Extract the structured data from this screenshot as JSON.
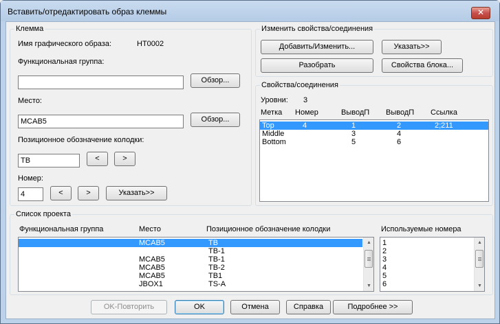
{
  "window": {
    "title": "Вставить/отредактировать образ клеммы",
    "close": "✕"
  },
  "terminal": {
    "group_title": "Клемма",
    "graphic_name_label": "Имя графического образа:",
    "graphic_name_value": "HT0002",
    "func_group_label": "Функциональная группа:",
    "func_group_value": "",
    "browse_label": "Обзор...",
    "location_label": "Место:",
    "location_value": "MCAB5",
    "block_pos_label": "Позиционное обозначение колодки:",
    "block_pos_value": "TB",
    "prev_label": "<",
    "next_label": ">",
    "number_label": "Номер:",
    "number_value": "4",
    "pick_label": "Указать>>"
  },
  "modify": {
    "group_title": "Изменить свойства/соединения",
    "add_edit": "Добавить/Изменить...",
    "pick": "Указать>>",
    "explode": "Разобрать",
    "block_props": "Свойства блока..."
  },
  "props": {
    "group_title": "Свойства/соединения",
    "levels_label": "Уровни:",
    "levels_value": "3",
    "headers": [
      "Метка",
      "Номер",
      "ВыводП",
      "ВыводП",
      "Ссылка"
    ],
    "rows": [
      [
        "Top",
        "4",
        "1",
        "2",
        "2;211"
      ],
      [
        "Middle",
        "",
        "3",
        "4",
        ""
      ],
      [
        "Bottom",
        "",
        "5",
        "6",
        ""
      ]
    ]
  },
  "project": {
    "group_title": "Список проекта",
    "headers": [
      "Функциональная группа",
      "Место",
      "Позиционное обозначение колодки"
    ],
    "rows": [
      [
        "",
        "MCAB5",
        "TB"
      ],
      [
        "",
        "",
        "TB-1"
      ],
      [
        "",
        "MCAB5",
        "TB-1"
      ],
      [
        "",
        "MCAB5",
        "TB-2"
      ],
      [
        "",
        "MCAB5",
        "TB1"
      ],
      [
        "",
        "JBOX1",
        "TS-A"
      ]
    ],
    "used_numbers_header": "Используемые номера",
    "used_numbers": [
      "1",
      "2",
      "3",
      "4",
      "5",
      "6"
    ]
  },
  "footer": {
    "ok_repeat": "OK-Повторить",
    "ok": "OK",
    "cancel": "Отмена",
    "help": "Справка",
    "details": "Подробнее >>"
  }
}
